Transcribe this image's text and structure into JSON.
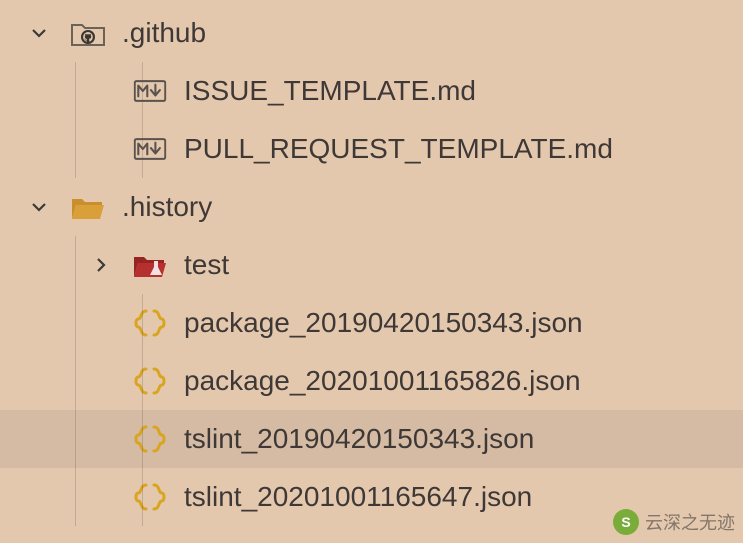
{
  "tree": {
    "rows": [
      {
        "id": "github-folder",
        "level": 0,
        "kind": "folder-github",
        "expanded": true,
        "label": ".github",
        "selected": false
      },
      {
        "id": "issue-tmpl",
        "level": 1,
        "kind": "markdown",
        "expanded": null,
        "label": "ISSUE_TEMPLATE.md",
        "selected": false
      },
      {
        "id": "pr-tmpl",
        "level": 1,
        "kind": "markdown",
        "expanded": null,
        "label": "PULL_REQUEST_TEMPLATE.md",
        "selected": false
      },
      {
        "id": "history-folder",
        "level": 0,
        "kind": "folder-open",
        "expanded": true,
        "label": ".history",
        "selected": false
      },
      {
        "id": "test-folder",
        "level": 1,
        "kind": "folder-test",
        "expanded": false,
        "label": "test",
        "selected": false
      },
      {
        "id": "pkg1",
        "level": 1,
        "kind": "json",
        "expanded": null,
        "label": "package_20190420150343.json",
        "selected": false
      },
      {
        "id": "pkg2",
        "level": 1,
        "kind": "json",
        "expanded": null,
        "label": "package_20201001165826.json",
        "selected": false
      },
      {
        "id": "tslint1",
        "level": 1,
        "kind": "json",
        "expanded": null,
        "label": "tslint_20190420150343.json",
        "selected": true
      },
      {
        "id": "tslint2",
        "level": 1,
        "kind": "json",
        "expanded": null,
        "label": "tslint_20201001165647.json",
        "selected": false
      }
    ]
  },
  "watermark": {
    "text": "云深之无迹"
  },
  "colors": {
    "bg": "#e4c8ae",
    "selected": "#d5bba3",
    "json": "#d9a521",
    "folder": "#d9a03a",
    "test": "#b5302e",
    "md_border": "#5a524c",
    "text": "#3e3836"
  }
}
